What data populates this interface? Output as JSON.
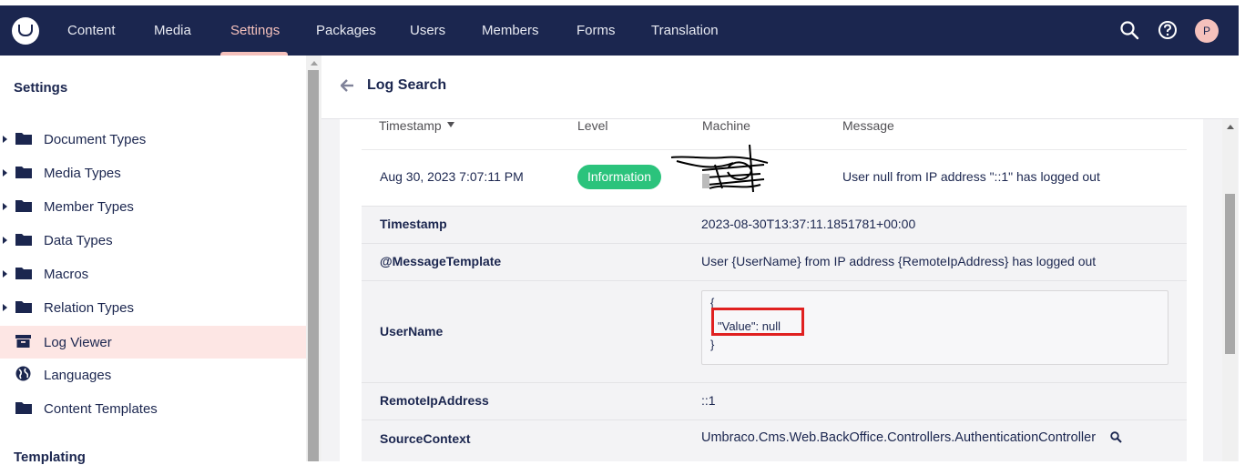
{
  "header": {
    "nav": [
      "Content",
      "Media",
      "Settings",
      "Packages",
      "Users",
      "Members",
      "Forms",
      "Translation"
    ],
    "active_nav": "Settings",
    "avatar_initial": "P",
    "icons": [
      "umbraco-logo-icon",
      "search-icon",
      "help-icon",
      "avatar"
    ]
  },
  "sidebar": {
    "title": "Settings",
    "items": [
      {
        "label": "Document Types",
        "icon": "folder-icon",
        "expandable": true
      },
      {
        "label": "Media Types",
        "icon": "folder-icon",
        "expandable": true
      },
      {
        "label": "Member Types",
        "icon": "folder-icon",
        "expandable": true
      },
      {
        "label": "Data Types",
        "icon": "folder-icon",
        "expandable": true
      },
      {
        "label": "Macros",
        "icon": "folder-icon",
        "expandable": true
      },
      {
        "label": "Relation Types",
        "icon": "folder-icon",
        "expandable": true
      },
      {
        "label": "Log Viewer",
        "icon": "archive-icon",
        "expandable": false,
        "active": true
      },
      {
        "label": "Languages",
        "icon": "globe-icon",
        "expandable": false
      },
      {
        "label": "Content Templates",
        "icon": "folder-icon",
        "expandable": false
      }
    ],
    "section": "Templating"
  },
  "main": {
    "title": "Log Search",
    "columns": {
      "timestamp": "Timestamp",
      "level": "Level",
      "machine": "Machine",
      "message": "Message"
    },
    "entry": {
      "timestamp": "Aug 30, 2023 7:07:11 PM",
      "level": "Information",
      "message": "User null from IP address \"::1\" has logged out"
    },
    "details": {
      "timestamp_key": "Timestamp",
      "timestamp_val": "2023-08-30T13:37:11.1851781+00:00",
      "template_key": "@MessageTemplate",
      "template_val": "User {UserName} from IP address {RemoteIpAddress} has logged out",
      "username_key": "UserName",
      "username_json": [
        "{",
        "\"Value\": null",
        "}"
      ],
      "remote_key": "RemoteIpAddress",
      "remote_val": "::1",
      "source_key": "SourceContext",
      "source_val": "Umbraco.Cms.Web.BackOffice.Controllers.AuthenticationController"
    }
  },
  "colors": {
    "header": "#1b264f",
    "active": "#f5c1bc",
    "badge": "#2bc37c",
    "highlight": "#e02020"
  }
}
